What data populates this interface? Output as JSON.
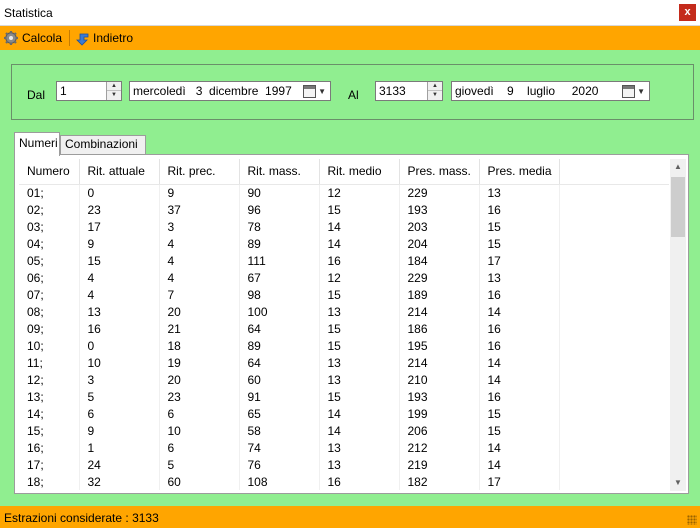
{
  "window": {
    "title": "Statistica",
    "close_label": "x"
  },
  "toolbar": {
    "calcola": "Calcola",
    "indietro": "Indietro"
  },
  "filters": {
    "dal_label": "Dal",
    "dal_value": "1",
    "dal_date": "mercoledì   3  dicembre  1997",
    "al_label": "Al",
    "al_value": "3133",
    "al_date": "giovedì    9    luglio     2020"
  },
  "tabs": [
    "Numeri",
    "Combinazioni"
  ],
  "table": {
    "columns": [
      "Numero",
      "Rit. attuale",
      "Rit. prec.",
      "Rit. mass.",
      "Rit. medio",
      "Pres. mass.",
      "Pres. media"
    ],
    "rows": [
      [
        "01;",
        "0",
        "9",
        "90",
        "12",
        "229",
        "13"
      ],
      [
        "02;",
        "23",
        "37",
        "96",
        "15",
        "193",
        "16"
      ],
      [
        "03;",
        "17",
        "3",
        "78",
        "14",
        "203",
        "15"
      ],
      [
        "04;",
        "9",
        "4",
        "89",
        "14",
        "204",
        "15"
      ],
      [
        "05;",
        "15",
        "4",
        "111",
        "16",
        "184",
        "17"
      ],
      [
        "06;",
        "4",
        "4",
        "67",
        "12",
        "229",
        "13"
      ],
      [
        "07;",
        "4",
        "7",
        "98",
        "15",
        "189",
        "16"
      ],
      [
        "08;",
        "13",
        "20",
        "100",
        "13",
        "214",
        "14"
      ],
      [
        "09;",
        "16",
        "21",
        "64",
        "15",
        "186",
        "16"
      ],
      [
        "10;",
        "0",
        "18",
        "89",
        "15",
        "195",
        "16"
      ],
      [
        "11;",
        "10",
        "19",
        "64",
        "13",
        "214",
        "14"
      ],
      [
        "12;",
        "3",
        "20",
        "60",
        "13",
        "210",
        "14"
      ],
      [
        "13;",
        "5",
        "23",
        "91",
        "15",
        "193",
        "16"
      ],
      [
        "14;",
        "6",
        "6",
        "65",
        "14",
        "199",
        "15"
      ],
      [
        "15;",
        "9",
        "10",
        "58",
        "14",
        "206",
        "15"
      ],
      [
        "16;",
        "1",
        "6",
        "74",
        "13",
        "212",
        "14"
      ],
      [
        "17;",
        "24",
        "5",
        "76",
        "13",
        "219",
        "14"
      ],
      [
        "18;",
        "32",
        "60",
        "108",
        "16",
        "182",
        "17"
      ]
    ]
  },
  "status": {
    "text": "Estrazioni considerate : 3133"
  },
  "icons": {
    "calcola": "gear-icon",
    "indietro": "back-arrow-icon",
    "calendar": "calendar-icon"
  },
  "colors": {
    "accent": "#ffa500",
    "panel": "#90ee90"
  }
}
